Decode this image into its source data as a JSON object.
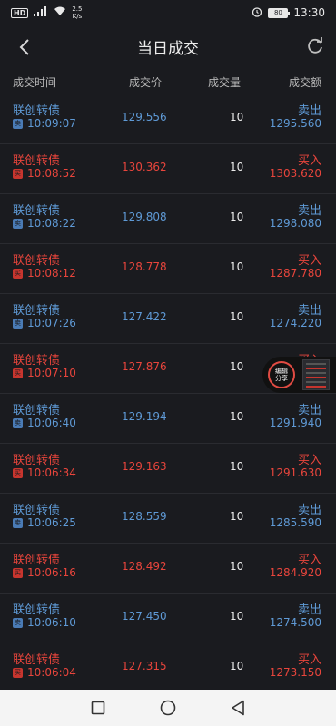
{
  "status_bar": {
    "network_badge": "HD",
    "signal": "4G",
    "net_speed_value": "2.5",
    "net_speed_unit": "K/s",
    "battery_level": "80",
    "clock": "13:30"
  },
  "nav": {
    "title": "当日成交"
  },
  "columns": {
    "time": "成交时间",
    "price": "成交价",
    "volume": "成交量",
    "amount": "成交额"
  },
  "trades": [
    {
      "name": "联创转债",
      "tag": "卖",
      "time": "10:09:07",
      "price": "129.556",
      "volume": "10",
      "side": "卖出",
      "amount": "1295.560",
      "type": "sell"
    },
    {
      "name": "联创转债",
      "tag": "买",
      "time": "10:08:52",
      "price": "130.362",
      "volume": "10",
      "side": "买入",
      "amount": "1303.620",
      "type": "buy"
    },
    {
      "name": "联创转债",
      "tag": "卖",
      "time": "10:08:22",
      "price": "129.808",
      "volume": "10",
      "side": "卖出",
      "amount": "1298.080",
      "type": "sell"
    },
    {
      "name": "联创转债",
      "tag": "买",
      "time": "10:08:12",
      "price": "128.778",
      "volume": "10",
      "side": "买入",
      "amount": "1287.780",
      "type": "buy"
    },
    {
      "name": "联创转债",
      "tag": "卖",
      "time": "10:07:26",
      "price": "127.422",
      "volume": "10",
      "side": "卖出",
      "amount": "1274.220",
      "type": "sell"
    },
    {
      "name": "联创转债",
      "tag": "买",
      "time": "10:07:10",
      "price": "127.876",
      "volume": "10",
      "side": "买入",
      "amount": "",
      "type": "buy"
    },
    {
      "name": "联创转债",
      "tag": "卖",
      "time": "10:06:40",
      "price": "129.194",
      "volume": "10",
      "side": "卖出",
      "amount": "1291.940",
      "type": "sell"
    },
    {
      "name": "联创转债",
      "tag": "买",
      "time": "10:06:34",
      "price": "129.163",
      "volume": "10",
      "side": "买入",
      "amount": "1291.630",
      "type": "buy"
    },
    {
      "name": "联创转债",
      "tag": "卖",
      "time": "10:06:25",
      "price": "128.559",
      "volume": "10",
      "side": "卖出",
      "amount": "1285.590",
      "type": "sell"
    },
    {
      "name": "联创转债",
      "tag": "买",
      "time": "10:06:16",
      "price": "128.492",
      "volume": "10",
      "side": "买入",
      "amount": "1284.920",
      "type": "buy"
    },
    {
      "name": "联创转债",
      "tag": "卖",
      "time": "10:06:10",
      "price": "127.450",
      "volume": "10",
      "side": "卖出",
      "amount": "1274.500",
      "type": "sell"
    },
    {
      "name": "联创转债",
      "tag": "买",
      "time": "10:06:04",
      "price": "127.315",
      "volume": "10",
      "side": "买入",
      "amount": "1273.150",
      "type": "buy"
    }
  ],
  "float_widget": {
    "label_line1": "编辑",
    "label_line2": "分享"
  },
  "colors": {
    "background": "#1a1b1f",
    "sell": "#5f9ad6",
    "buy": "#e8453c",
    "divider": "#2a2b30"
  }
}
